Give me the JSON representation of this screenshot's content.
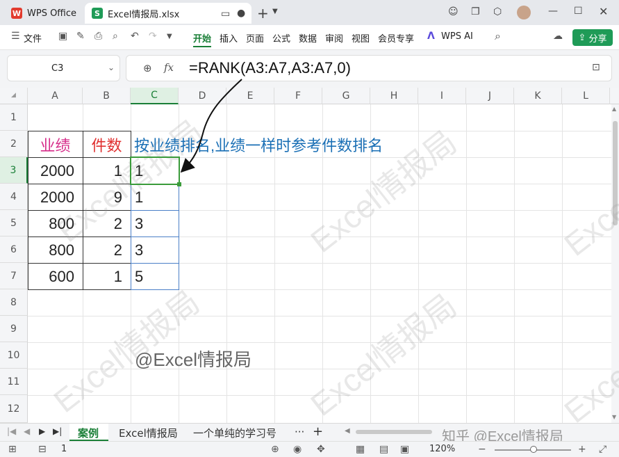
{
  "titlebar": {
    "app_tab": "WPS Office",
    "file_tab": "Excel情报局.xlsx",
    "app_logo": "W",
    "file_logo": "S"
  },
  "menu": {
    "file": "文件",
    "items": [
      "开始",
      "插入",
      "页面",
      "公式",
      "数据",
      "审阅",
      "视图",
      "会员专享"
    ],
    "wps_ai": "WPS AI",
    "share": "分享"
  },
  "formula_bar": {
    "name_box": "C3",
    "fx": "fx",
    "formula": "=RANK(A3:A7,A3:A7,0)"
  },
  "columns": [
    "A",
    "B",
    "C",
    "D",
    "E",
    "F",
    "G",
    "H",
    "I",
    "J",
    "K",
    "L"
  ],
  "rows": [
    "1",
    "2",
    "3",
    "4",
    "5",
    "6",
    "7",
    "8",
    "9",
    "10",
    "11",
    "12"
  ],
  "table": {
    "header_a": "业绩",
    "header_b": "件数",
    "header_note": "按业绩排名,业绩一样时参考件数排名",
    "data": [
      {
        "a": "2000",
        "b": "1",
        "c": "1"
      },
      {
        "a": "2000",
        "b": "9",
        "c": "1"
      },
      {
        "a": "800",
        "b": "2",
        "c": "3"
      },
      {
        "a": "800",
        "b": "2",
        "c": "3"
      },
      {
        "a": "600",
        "b": "1",
        "c": "5"
      }
    ]
  },
  "credit": "@Excel情报局",
  "watermark_text": "Excel情报局",
  "sheets": {
    "active": "案例",
    "others": [
      "Excel情报局",
      "一个单纯的学习号"
    ],
    "more": "···"
  },
  "status": {
    "count": "1",
    "zoom": "120%",
    "zhihu": "知乎 @Excel情报局"
  },
  "colors": {
    "header_a": "#d62d8a",
    "header_b": "#e03030",
    "header_note": "#1a6fb5",
    "accent": "#1f9b57"
  }
}
